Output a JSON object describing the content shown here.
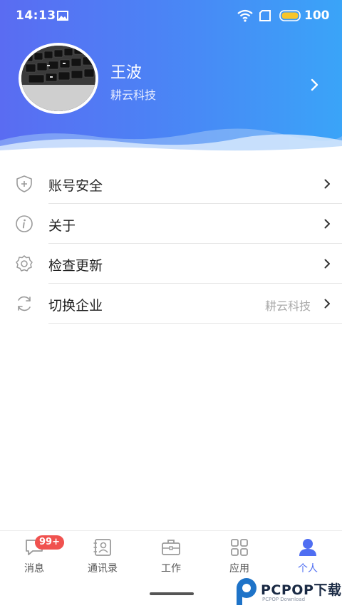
{
  "status_bar": {
    "time": "14:13",
    "battery": "100"
  },
  "profile": {
    "name": "王波",
    "company": "耕云科技"
  },
  "menu": [
    {
      "label": "账号安全",
      "icon": "shield-plus-icon"
    },
    {
      "label": "关于",
      "icon": "info-icon"
    },
    {
      "label": "检查更新",
      "icon": "gear-icon"
    },
    {
      "label": "切换企业",
      "icon": "refresh-icon",
      "value": "耕云科技"
    }
  ],
  "tabs": [
    {
      "label": "消息",
      "icon": "message-icon",
      "badge": "99+"
    },
    {
      "label": "通讯录",
      "icon": "contacts-icon"
    },
    {
      "label": "工作",
      "icon": "briefcase-icon"
    },
    {
      "label": "应用",
      "icon": "apps-grid-icon"
    },
    {
      "label": "个人",
      "icon": "person-icon",
      "active": true
    }
  ],
  "watermark": {
    "text": "PCPOP下载",
    "sub": "PCPOP Download"
  },
  "colors": {
    "accent": "#4f6ef2",
    "badge": "#f0524f",
    "gradient_start": "#5a6cf2",
    "gradient_end": "#3aa4f8"
  }
}
